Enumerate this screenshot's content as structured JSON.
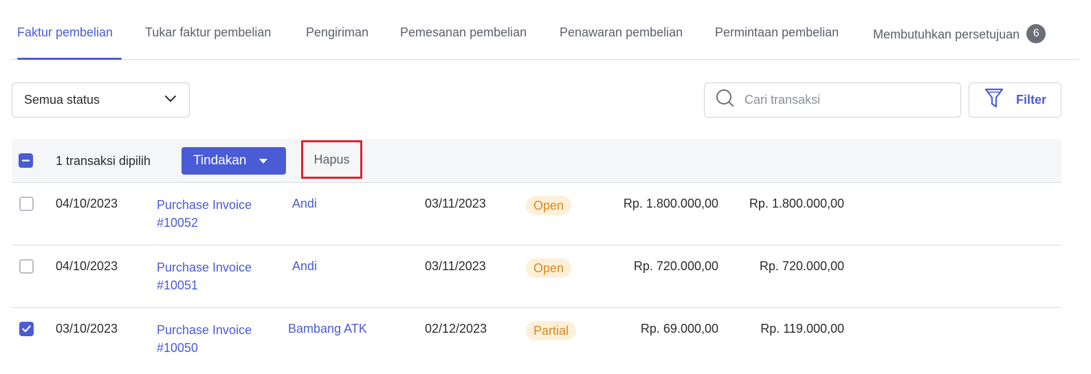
{
  "tabs": [
    {
      "label": "Faktur pembelian",
      "active": true
    },
    {
      "label": "Tukar faktur pembelian"
    },
    {
      "label": "Pengiriman"
    },
    {
      "label": "Pemesanan pembelian"
    },
    {
      "label": "Penawaran pembelian"
    },
    {
      "label": "Permintaan pembelian"
    },
    {
      "label": "Membutuhkan persetujuan",
      "badge": "6"
    }
  ],
  "filters": {
    "status_value": "Semua status",
    "search_placeholder": "Cari transaksi",
    "filter_label": "Filter"
  },
  "selection": {
    "count_label": "1 transaksi dipilih",
    "action_label": "Tindakan",
    "delete_label": "Hapus"
  },
  "rows": [
    {
      "checked": false,
      "date": "04/10/2023",
      "invoice_line1": "Purchase Invoice",
      "invoice_line2": "#10052",
      "vendor": "Andi",
      "due_date": "03/11/2023",
      "status": "Open",
      "balance": "Rp. 1.800.000,00",
      "total": "Rp. 1.800.000,00"
    },
    {
      "checked": false,
      "date": "04/10/2023",
      "invoice_line1": "Purchase Invoice",
      "invoice_line2": "#10051",
      "vendor": "Andi",
      "due_date": "03/11/2023",
      "status": "Open",
      "balance": "Rp. 720.000,00",
      "total": "Rp. 720.000,00"
    },
    {
      "checked": true,
      "date": "03/10/2023",
      "invoice_line1": "Purchase Invoice",
      "invoice_line2": "#10050",
      "vendor": "Bambang ATK",
      "due_date": "02/12/2023",
      "status": "Partial",
      "balance": "Rp. 69.000,00",
      "total": "Rp. 119.000,00"
    }
  ],
  "colors": {
    "accent": "#4a5bd6",
    "status_bg": "#fdf0d8",
    "status_text": "#d9881c",
    "highlight": "#e0202a"
  }
}
